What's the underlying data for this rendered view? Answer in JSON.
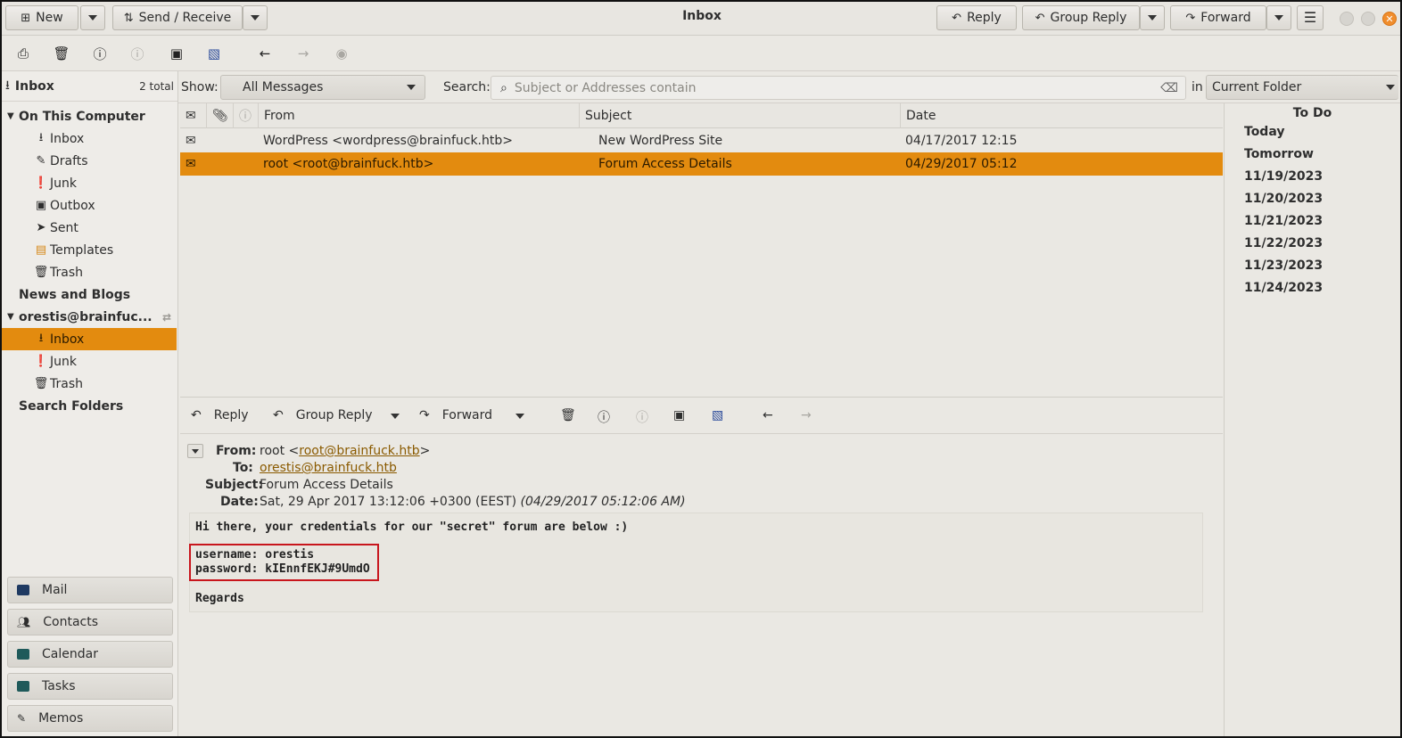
{
  "window": {
    "title": "Inbox"
  },
  "header": {
    "new_label": "New",
    "send_receive_label": "Send / Receive",
    "reply_label": "Reply",
    "group_reply_label": "Group Reply",
    "forward_label": "Forward"
  },
  "sidebar": {
    "title": "Inbox",
    "total": "2 total",
    "sections": {
      "on_this_computer": "On This Computer",
      "news_and_blogs": "News and Blogs",
      "account": "orestis@brainfuc...",
      "search_folders": "Search Folders"
    },
    "local_folders": [
      "Inbox",
      "Drafts",
      "Junk",
      "Outbox",
      "Sent",
      "Templates",
      "Trash"
    ],
    "account_folders": [
      "Inbox",
      "Junk",
      "Trash"
    ],
    "switcher": [
      "Mail",
      "Contacts",
      "Calendar",
      "Tasks",
      "Memos"
    ]
  },
  "filter": {
    "show_label": "Show:",
    "show_value": "All Messages",
    "search_label": "Search:",
    "search_placeholder": "Subject or Addresses contain",
    "in_label": "in",
    "scope_value": "Current Folder"
  },
  "message_list": {
    "columns": [
      "From",
      "Subject",
      "Date"
    ],
    "rows": [
      {
        "from": "WordPress <wordpress@brainfuck.htb>",
        "subject": "New WordPress Site",
        "date": "04/17/2017 12:15"
      },
      {
        "from": "root <root@brainfuck.htb>",
        "subject": "Forum Access Details",
        "date": "04/29/2017 05:12"
      }
    ]
  },
  "todo": {
    "title": "To Do",
    "days": [
      "Today",
      "Tomorrow",
      "11/19/2023",
      "11/20/2023",
      "11/21/2023",
      "11/22/2023",
      "11/23/2023",
      "11/24/2023"
    ]
  },
  "preview": {
    "toolbar": {
      "reply": "Reply",
      "group_reply": "Group Reply",
      "forward": "Forward"
    },
    "labels": {
      "from": "From:",
      "to": "To:",
      "subject": "Subject:",
      "date": "Date:"
    },
    "from_name": "root <",
    "from_email": "root@brainfuck.htb",
    "from_close": ">",
    "to_email": "orestis@brainfuck.htb",
    "subject": "Forum Access Details",
    "date": "Sat, 29 Apr 2017 13:12:06 +0300 (EEST)",
    "date_local": "(04/29/2017 05:12:06 AM)",
    "body_line1": "Hi there, your credentials for our \"secret\" forum are below :)",
    "body_line2": "username: orestis",
    "body_line3": "password: kIEnnfEKJ#9UmdO",
    "body_line4": "Regards"
  },
  "colors": {
    "selection": "#e38b0f",
    "highlight_box": "#c8161d"
  }
}
